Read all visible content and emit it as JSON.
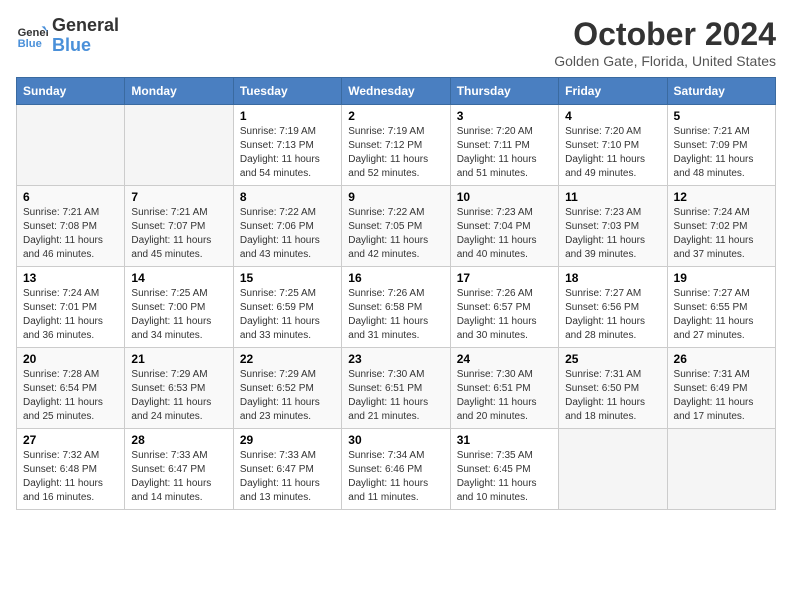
{
  "header": {
    "logo_line1": "General",
    "logo_line2": "Blue",
    "title": "October 2024",
    "subtitle": "Golden Gate, Florida, United States"
  },
  "days_of_week": [
    "Sunday",
    "Monday",
    "Tuesday",
    "Wednesday",
    "Thursday",
    "Friday",
    "Saturday"
  ],
  "weeks": [
    [
      {
        "day": "",
        "info": ""
      },
      {
        "day": "",
        "info": ""
      },
      {
        "day": "1",
        "info": "Sunrise: 7:19 AM\nSunset: 7:13 PM\nDaylight: 11 hours and 54 minutes."
      },
      {
        "day": "2",
        "info": "Sunrise: 7:19 AM\nSunset: 7:12 PM\nDaylight: 11 hours and 52 minutes."
      },
      {
        "day": "3",
        "info": "Sunrise: 7:20 AM\nSunset: 7:11 PM\nDaylight: 11 hours and 51 minutes."
      },
      {
        "day": "4",
        "info": "Sunrise: 7:20 AM\nSunset: 7:10 PM\nDaylight: 11 hours and 49 minutes."
      },
      {
        "day": "5",
        "info": "Sunrise: 7:21 AM\nSunset: 7:09 PM\nDaylight: 11 hours and 48 minutes."
      }
    ],
    [
      {
        "day": "6",
        "info": "Sunrise: 7:21 AM\nSunset: 7:08 PM\nDaylight: 11 hours and 46 minutes."
      },
      {
        "day": "7",
        "info": "Sunrise: 7:21 AM\nSunset: 7:07 PM\nDaylight: 11 hours and 45 minutes."
      },
      {
        "day": "8",
        "info": "Sunrise: 7:22 AM\nSunset: 7:06 PM\nDaylight: 11 hours and 43 minutes."
      },
      {
        "day": "9",
        "info": "Sunrise: 7:22 AM\nSunset: 7:05 PM\nDaylight: 11 hours and 42 minutes."
      },
      {
        "day": "10",
        "info": "Sunrise: 7:23 AM\nSunset: 7:04 PM\nDaylight: 11 hours and 40 minutes."
      },
      {
        "day": "11",
        "info": "Sunrise: 7:23 AM\nSunset: 7:03 PM\nDaylight: 11 hours and 39 minutes."
      },
      {
        "day": "12",
        "info": "Sunrise: 7:24 AM\nSunset: 7:02 PM\nDaylight: 11 hours and 37 minutes."
      }
    ],
    [
      {
        "day": "13",
        "info": "Sunrise: 7:24 AM\nSunset: 7:01 PM\nDaylight: 11 hours and 36 minutes."
      },
      {
        "day": "14",
        "info": "Sunrise: 7:25 AM\nSunset: 7:00 PM\nDaylight: 11 hours and 34 minutes."
      },
      {
        "day": "15",
        "info": "Sunrise: 7:25 AM\nSunset: 6:59 PM\nDaylight: 11 hours and 33 minutes."
      },
      {
        "day": "16",
        "info": "Sunrise: 7:26 AM\nSunset: 6:58 PM\nDaylight: 11 hours and 31 minutes."
      },
      {
        "day": "17",
        "info": "Sunrise: 7:26 AM\nSunset: 6:57 PM\nDaylight: 11 hours and 30 minutes."
      },
      {
        "day": "18",
        "info": "Sunrise: 7:27 AM\nSunset: 6:56 PM\nDaylight: 11 hours and 28 minutes."
      },
      {
        "day": "19",
        "info": "Sunrise: 7:27 AM\nSunset: 6:55 PM\nDaylight: 11 hours and 27 minutes."
      }
    ],
    [
      {
        "day": "20",
        "info": "Sunrise: 7:28 AM\nSunset: 6:54 PM\nDaylight: 11 hours and 25 minutes."
      },
      {
        "day": "21",
        "info": "Sunrise: 7:29 AM\nSunset: 6:53 PM\nDaylight: 11 hours and 24 minutes."
      },
      {
        "day": "22",
        "info": "Sunrise: 7:29 AM\nSunset: 6:52 PM\nDaylight: 11 hours and 23 minutes."
      },
      {
        "day": "23",
        "info": "Sunrise: 7:30 AM\nSunset: 6:51 PM\nDaylight: 11 hours and 21 minutes."
      },
      {
        "day": "24",
        "info": "Sunrise: 7:30 AM\nSunset: 6:51 PM\nDaylight: 11 hours and 20 minutes."
      },
      {
        "day": "25",
        "info": "Sunrise: 7:31 AM\nSunset: 6:50 PM\nDaylight: 11 hours and 18 minutes."
      },
      {
        "day": "26",
        "info": "Sunrise: 7:31 AM\nSunset: 6:49 PM\nDaylight: 11 hours and 17 minutes."
      }
    ],
    [
      {
        "day": "27",
        "info": "Sunrise: 7:32 AM\nSunset: 6:48 PM\nDaylight: 11 hours and 16 minutes."
      },
      {
        "day": "28",
        "info": "Sunrise: 7:33 AM\nSunset: 6:47 PM\nDaylight: 11 hours and 14 minutes."
      },
      {
        "day": "29",
        "info": "Sunrise: 7:33 AM\nSunset: 6:47 PM\nDaylight: 11 hours and 13 minutes."
      },
      {
        "day": "30",
        "info": "Sunrise: 7:34 AM\nSunset: 6:46 PM\nDaylight: 11 hours and 11 minutes."
      },
      {
        "day": "31",
        "info": "Sunrise: 7:35 AM\nSunset: 6:45 PM\nDaylight: 11 hours and 10 minutes."
      },
      {
        "day": "",
        "info": ""
      },
      {
        "day": "",
        "info": ""
      }
    ]
  ]
}
